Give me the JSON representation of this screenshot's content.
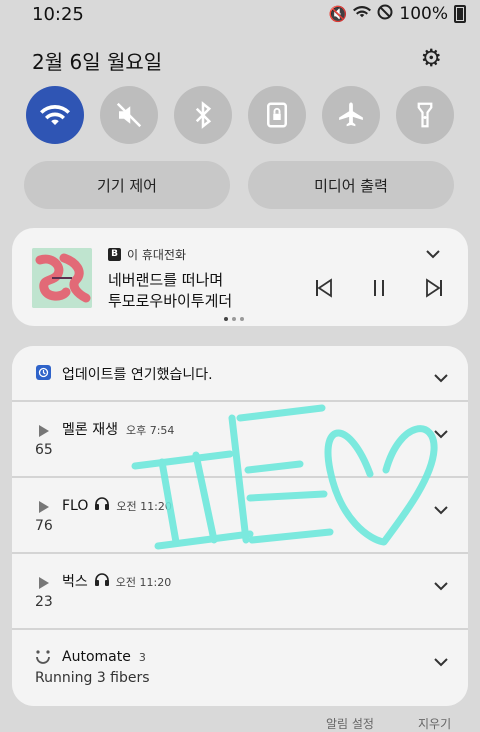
{
  "status": {
    "time": "10:25",
    "battery": "100%"
  },
  "date": "2월 6일 월요일",
  "toggles": [
    {
      "name": "wifi",
      "on": true
    },
    {
      "name": "mute",
      "on": false
    },
    {
      "name": "bluetooth",
      "on": false
    },
    {
      "name": "lock-rotation",
      "on": false
    },
    {
      "name": "airplane",
      "on": false
    },
    {
      "name": "flashlight",
      "on": false
    }
  ],
  "pills": {
    "device_control": "기기 제어",
    "media_output": "미디어 출력"
  },
  "media": {
    "source": "이 휴대전화",
    "title_line1": "네버랜드를 떠나며",
    "title_line2": "투모로우바이투게더"
  },
  "notifications": [
    {
      "title": "업데이트를 연기했습니다."
    },
    {
      "title": "멜론 재생",
      "time": "오후 7:54",
      "body": "65"
    },
    {
      "title": "FLO",
      "time": "오전 11:20",
      "body": "76"
    },
    {
      "title": "벅스",
      "time": "오전 11:20",
      "body": "23"
    },
    {
      "title": "Automate",
      "count": "3",
      "body": "Running 3 fibers"
    }
  ],
  "footer": {
    "settings": "알림 설정",
    "clear": "지우기"
  },
  "colors": {
    "accent": "#2f55b4",
    "scribble": "#6ee8dc"
  }
}
